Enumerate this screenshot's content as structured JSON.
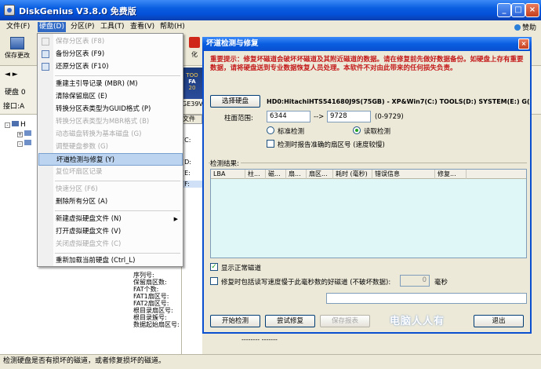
{
  "app": {
    "title": "DiskGenius V3.8.0 免费版"
  },
  "menubar": {
    "items": [
      {
        "label": "文件(F)"
      },
      {
        "label": "硬盘(D)"
      },
      {
        "label": "分区(P)"
      },
      {
        "label": "工具(T)"
      },
      {
        "label": "查看(V)"
      },
      {
        "label": "帮助(H)"
      }
    ],
    "help_button": "赞助"
  },
  "toolbar": {
    "save_label": "保存更改",
    "right_label": "化"
  },
  "diskbar": {
    "arrows": "◄ ►",
    "disk_label": "硬盘 0",
    "port_label": "接口:A",
    "ad_line1": "TOO",
    "ad_line2": "FA",
    "ad_line3": "20",
    "ge_text": "GE39V7"
  },
  "tree": {
    "root": "H",
    "mid_tab": "文件",
    "mid_cells": [
      "(C:",
      "(D:",
      "(E:",
      "(F:"
    ]
  },
  "info_labels": [
    "序列号:",
    "保留扇区数:",
    "FAT个数:",
    "FAT1扇区号:",
    "FAT2扇区号:",
    "根目录扇区号:",
    "根目录簇号:",
    "数据起始扇区号:"
  ],
  "bottom_dash": "-------- -------",
  "statusbar": {
    "text": "检测硬盘是否有损坏的磁道，或者修复损坏的磁道。"
  },
  "dropdown": {
    "items": [
      {
        "label": "保存分区表 (F8)",
        "disabled": true
      },
      {
        "label": "备份分区表 (F9)",
        "disabled": false
      },
      {
        "label": "还原分区表 (F10)",
        "disabled": false
      },
      {
        "label": "重建主引导记录 (MBR) (M)",
        "disabled": false
      },
      {
        "label": "清除保留扇区 (E)",
        "disabled": false
      },
      {
        "label": "转换分区表类型为GUID格式 (P)",
        "disabled": false
      },
      {
        "label": "转换分区表类型为MBR格式 (B)",
        "disabled": true
      },
      {
        "label": "动态磁盘转换为基本磁盘 (G)",
        "disabled": true
      },
      {
        "label": "调整硬盘参数 (G)",
        "disabled": true
      },
      {
        "label": "坏道检测与修复 (Y)",
        "disabled": false
      },
      {
        "label": "复位坏扇区记录",
        "disabled": true
      },
      {
        "label": "快速分区 (F6)",
        "disabled": true
      },
      {
        "label": "删除所有分区 (A)",
        "disabled": false
      },
      {
        "label": "新建虚拟硬盘文件 (N)",
        "disabled": false
      },
      {
        "label": "打开虚拟硬盘文件 (V)",
        "disabled": false
      },
      {
        "label": "关闭虚拟硬盘文件 (C)",
        "disabled": true
      },
      {
        "label": "重新加载当前硬盘 (Ctrl_L)",
        "disabled": false
      }
    ]
  },
  "dialog": {
    "title": "坏道检测与修复",
    "warning": "重要提示：修复坏磁道会破坏坏磁道及其附近磁道的数据。请在修复前先做好数据备份。如硬盘上存有重要数据，请将硬盘送到专业数据恢复人员处理。本软件不对由此带来的任何损失负责。",
    "select_disk_button": "选择硬盘",
    "disk_info": "HD0:HitachiHTS541680J9S(75GB) - XP&Win7(C:) TOOLS(D:) SYSTEM(E:) G(",
    "cylinder_label": "柱面范围:",
    "cylinder_from": "6344",
    "range_sep": "-->",
    "cylinder_to": "9728",
    "range_hint": "(0-9729)",
    "radio_standard": "标准检测",
    "radio_read": "读取检测",
    "check_report": "检测时报告准确的扇区号 (速度较慢)",
    "results_label": "检测结果:",
    "columns": [
      "LBA",
      "柱...",
      "磁...",
      "扇...",
      "扇区...",
      "耗时 (毫秒)",
      "错误信息",
      "修复..."
    ],
    "check_show_normal": "显示正常磁道",
    "check_repair": "修复时包括读写速度慢于此毫秒数的好磁道 (不破坏数据):",
    "ms_value": "0",
    "ms_label": "毫秒",
    "start_button": "开始检测",
    "try_repair_button": "尝试修复",
    "save_report_button": "保存报表",
    "exit_button": "退出",
    "watermark": "电脑人人有"
  }
}
